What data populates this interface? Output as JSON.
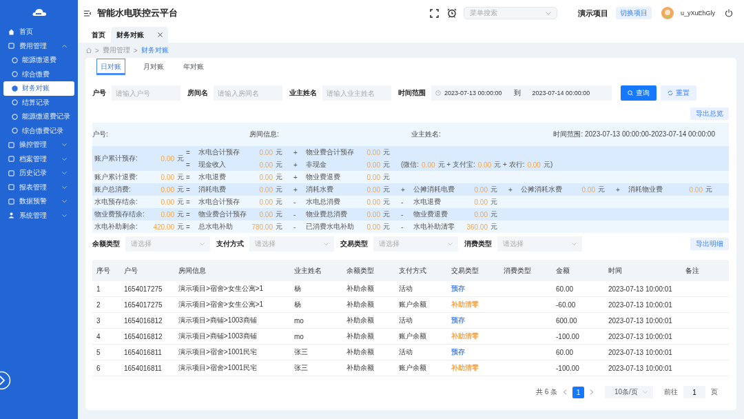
{
  "app": {
    "title": "智能水电联控云平台"
  },
  "header": {
    "search_placeholder": "菜单搜索",
    "project": "演示项目",
    "switch_button": "切换项目",
    "username": "u_yXuEhGly"
  },
  "sidebar": {
    "items": [
      {
        "label": "首页",
        "selected": false
      },
      {
        "label": "费用管理",
        "selected": false,
        "expanded": true,
        "children": [
          {
            "label": "能源缴退费",
            "selected": false
          },
          {
            "label": "综合缴费",
            "selected": false
          },
          {
            "label": "财务对账",
            "selected": true
          },
          {
            "label": "结算记录",
            "selected": false
          },
          {
            "label": "能源缴退费记录",
            "selected": false
          },
          {
            "label": "综合缴费记录",
            "selected": false
          }
        ]
      },
      {
        "label": "操控管理",
        "selected": false,
        "expanded": false
      },
      {
        "label": "档案管理",
        "selected": false,
        "expanded": false
      },
      {
        "label": "历史记录",
        "selected": false,
        "expanded": false
      },
      {
        "label": "报表管理",
        "selected": false,
        "expanded": false
      },
      {
        "label": "数据预警",
        "selected": false,
        "expanded": false
      },
      {
        "label": "系统管理",
        "selected": false,
        "expanded": false
      }
    ]
  },
  "tabs": [
    {
      "label": "首页",
      "selected": false,
      "closable": false
    },
    {
      "label": "财务对账",
      "selected": true,
      "closable": true
    }
  ],
  "breadcrumb": [
    {
      "separator": ">",
      "label": "费用管理"
    },
    {
      "separator": ">",
      "label": "财务对账"
    }
  ],
  "period_tabs": [
    {
      "label": "日对账",
      "selected": true
    },
    {
      "label": "月对账",
      "selected": false
    },
    {
      "label": "年对账",
      "selected": false
    }
  ],
  "filters": [
    {
      "label": "户号",
      "placeholder": "请输入户号"
    },
    {
      "label": "房间名",
      "placeholder": "请输入房间名"
    },
    {
      "label": "业主姓名",
      "placeholder": "请输入业主姓名"
    }
  ],
  "time_range": {
    "label": "时间范围",
    "start": "2023-07-13 00:00:00",
    "separator": "到",
    "end": "2023-07-14 00:00:00"
  },
  "query_button": "查询",
  "reset_button": "重置",
  "export_summary_button": "导出总览",
  "summary": {
    "header": [
      "户号:",
      "房间信息:",
      "业主姓名:",
      "时间范围: 2023-07-13 00:00:00-2023-07-14 00:00:00"
    ],
    "rows": [
      {
        "label": "账户累计预存:",
        "value": "0.00",
        "unit": "元",
        "lines": [
          {
            "terms": [
              {
                "op": "=",
                "label": "水电合计预存",
                "value": "0.00",
                "unit": "元"
              },
              {
                "op": "+",
                "label": "物业费合计预存",
                "value": "0.00",
                "unit": "元"
              }
            ]
          },
          {
            "terms": [
              {
                "op": "=",
                "label": "现金收入",
                "value": "0.00",
                "unit": "元"
              },
              {
                "op": "+",
                "label": "非现金",
                "value": "0.00",
                "unit": "元"
              }
            ],
            "detail": [
              {
                "kind": "text",
                "text": "(微信:"
              },
              {
                "kind": "amount",
                "text": "0.00"
              },
              {
                "kind": "text",
                "text": "元 + 支付宝:"
              },
              {
                "kind": "amount",
                "text": "0.00"
              },
              {
                "kind": "text",
                "text": "元 + 农行:"
              },
              {
                "kind": "amount",
                "text": "0.00"
              },
              {
                "kind": "text",
                "text": "元)"
              }
            ]
          }
        ]
      },
      {
        "label": "账户累计退费:",
        "value": "0.00",
        "unit": "元",
        "lines": [
          {
            "terms": [
              {
                "op": "=",
                "label": "水电退费",
                "value": "0.00",
                "unit": "元"
              },
              {
                "op": "+",
                "label": "物业费退费",
                "value": "0.00",
                "unit": "元"
              }
            ]
          }
        ]
      },
      {
        "label": "账户总消费:",
        "value": "0.00",
        "unit": "元",
        "lines": [
          {
            "terms": [
              {
                "op": "=",
                "label": "消耗电费",
                "value": "0.00",
                "unit": "元"
              },
              {
                "op": "+",
                "label": "消耗水费",
                "value": "0.00",
                "unit": "元"
              },
              {
                "op": "+",
                "label": "公摊消耗电费",
                "value": "0.00",
                "unit": "元"
              },
              {
                "op": "+",
                "label": "公摊消耗水费",
                "value": "0.00",
                "unit": "元"
              },
              {
                "op": "+",
                "label": "消耗物业费",
                "value": "0.00",
                "unit": "元"
              }
            ]
          }
        ]
      },
      {
        "label": "水电预存结余:",
        "value": "0.00",
        "unit": "元",
        "lines": [
          {
            "terms": [
              {
                "op": "=",
                "label": "水电合计预存",
                "value": "0.00",
                "unit": "元"
              },
              {
                "op": "-",
                "label": "水电总消费",
                "value": "0.00",
                "unit": "元"
              },
              {
                "op": "-",
                "label": "水电退费",
                "value": "0.00",
                "unit": "元"
              }
            ]
          }
        ]
      },
      {
        "label": "物业费预存结余:",
        "value": "0.00",
        "unit": "元",
        "lines": [
          {
            "terms": [
              {
                "op": "=",
                "label": "物业费合计预存",
                "value": "0.00",
                "unit": "元"
              },
              {
                "op": "-",
                "label": "物业费总消费",
                "value": "0.00",
                "unit": "元"
              },
              {
                "op": "-",
                "label": "物业费退费",
                "value": "0.00",
                "unit": "元"
              }
            ]
          }
        ]
      },
      {
        "label": "水电补助剩余:",
        "value": "420.00",
        "unit": "元",
        "lines": [
          {
            "terms": [
              {
                "op": "=",
                "label": "总水电补助",
                "value": "780.00",
                "unit": "元"
              },
              {
                "op": "-",
                "label": "已消费水电补助",
                "value": "0.00",
                "unit": "元"
              },
              {
                "op": "-",
                "label": "水电补助清零",
                "value": "360.00",
                "unit": "元"
              }
            ]
          }
        ]
      }
    ]
  },
  "selects": [
    {
      "label": "余额类型",
      "placeholder": "请选择"
    },
    {
      "label": "支付方式",
      "placeholder": "请选择"
    },
    {
      "label": "交易类型",
      "placeholder": "请选择"
    },
    {
      "label": "消费类型",
      "placeholder": "请选择"
    }
  ],
  "export_detail_button": "导出明细",
  "table": {
    "columns": [
      "序号",
      "户号",
      "房间信息",
      "业主姓名",
      "余额类型",
      "支付方式",
      "交易类型",
      "消费类型",
      "金额",
      "时间",
      "备注"
    ],
    "rows": [
      {
        "no": "1",
        "account": "1654017275",
        "room": "演示项目>宿舍>女生公寓>1",
        "owner": "杨",
        "balance_type": "补助余额",
        "payment": "活动",
        "trade_type": "预存",
        "color": "#4f8ff7",
        "amount": "60.00",
        "time": "2023-07-13 10:00:01"
      },
      {
        "no": "2",
        "account": "1654017275",
        "room": "演示项目>宿舍>女生公寓>1",
        "owner": "杨",
        "balance_type": "补助余额",
        "payment": "账户余额",
        "trade_type": "补助清零",
        "color": "#f5a64a",
        "amount": "-60.00",
        "time": "2023-07-13 10:00:01"
      },
      {
        "no": "3",
        "account": "1654016812",
        "room": "演示项目>商铺>1003商铺",
        "owner": "mo",
        "balance_type": "补助余额",
        "payment": "活动",
        "trade_type": "预存",
        "color": "#4f8ff7",
        "amount": "600.00",
        "time": "2023-07-13 10:00:01"
      },
      {
        "no": "4",
        "account": "1654016812",
        "room": "演示项目>商铺>1003商铺",
        "owner": "mo",
        "balance_type": "补助余额",
        "payment": "账户余额",
        "trade_type": "补助清零",
        "color": "#f5a64a",
        "amount": "-100.00",
        "time": "2023-07-13 10:00:01"
      },
      {
        "no": "5",
        "account": "1654016811",
        "room": "演示项目>宿舍>1001民宅",
        "owner": "张三",
        "balance_type": "补助余额",
        "payment": "活动",
        "trade_type": "预存",
        "color": "#4f8ff7",
        "amount": "60.00",
        "time": "2023-07-13 10:00:01"
      },
      {
        "no": "6",
        "account": "1654016811",
        "room": "演示项目>宿舍>1001民宅",
        "owner": "张三",
        "balance_type": "补助余额",
        "payment": "账户余额",
        "trade_type": "补助清零",
        "color": "#f5a64a",
        "amount": "-100.00",
        "time": "2023-07-13 10:00:01"
      }
    ]
  },
  "pagination": {
    "total": "共 6 条",
    "pages": [
      {
        "label": "1",
        "selected": true
      }
    ],
    "page_size": "10条/页",
    "goto_label": "前往",
    "goto_value": "1",
    "goto_suffix": "页"
  }
}
